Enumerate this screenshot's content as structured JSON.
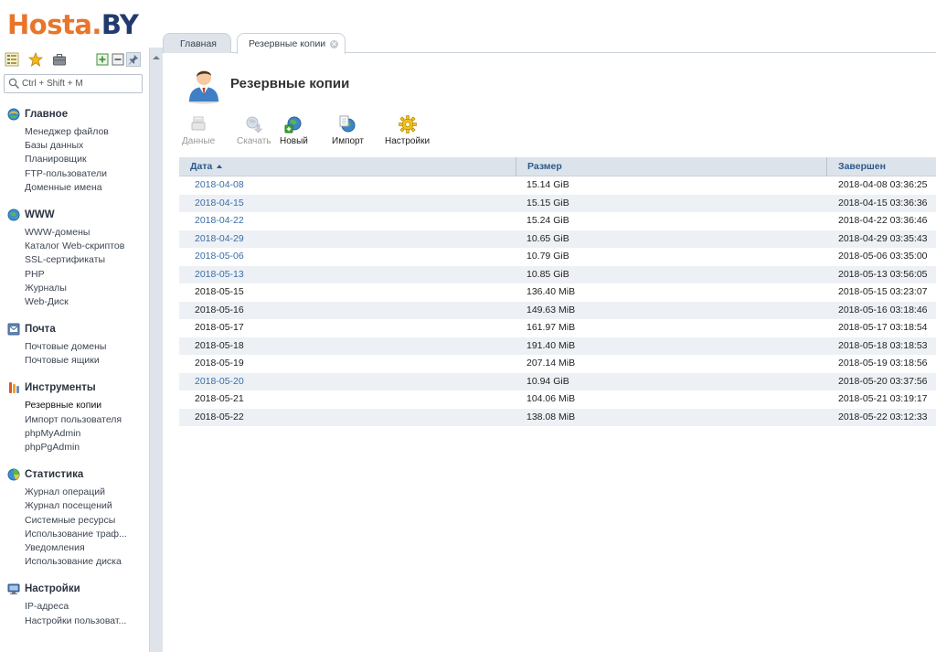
{
  "logo": {
    "part1": "Hosta.",
    "part2": "BY"
  },
  "search": {
    "placeholder": "Ctrl + Shift + M"
  },
  "side_tool_icons": [
    "tree-view-icon",
    "favorites-star-icon",
    "briefcase-icon",
    "expand-all-icon",
    "collapse-all-icon",
    "pin-icon"
  ],
  "menu": [
    {
      "title": "Главное",
      "icon": "home-globe-icon",
      "items": [
        "Менеджер файлов",
        "Базы данных",
        "Планировщик",
        "FTP-пользователи",
        "Доменные имена"
      ]
    },
    {
      "title": "WWW",
      "icon": "www-globe-icon",
      "items": [
        "WWW-домены",
        "Каталог Web-скриптов",
        "SSL-сертификаты",
        "PHP",
        "Журналы",
        "Web-Диск"
      ]
    },
    {
      "title": "Почта",
      "icon": "mail-icon",
      "items": [
        "Почтовые домены",
        "Почтовые ящики"
      ]
    },
    {
      "title": "Инструменты",
      "icon": "tools-icon",
      "items": [
        "Резервные копии",
        "Импорт пользователя",
        "phpMyAdmin",
        "phpPgAdmin"
      ]
    },
    {
      "title": "Статистика",
      "icon": "statistics-pie-icon",
      "items": [
        "Журнал операций",
        "Журнал посещений",
        "Системные ресурсы",
        "Использование траф...",
        "Уведомления",
        "Использование диска"
      ]
    },
    {
      "title": "Настройки",
      "icon": "settings-monitor-icon",
      "items": [
        "IP-адреса",
        "Настройки пользоват..."
      ]
    }
  ],
  "active_menu_item": "Резервные копии",
  "tabs": [
    {
      "label": "Главная",
      "active": false
    },
    {
      "label": "Резервные копии",
      "active": true
    }
  ],
  "page": {
    "title": "Резервные копии",
    "icon": "user-avatar-icon"
  },
  "toolbar": [
    {
      "label": "Данные",
      "icon": "data-icon",
      "disabled": true
    },
    {
      "label": "Скачать",
      "icon": "download-icon",
      "disabled": true
    },
    {
      "label": "Новый",
      "icon": "new-backup-icon",
      "disabled": false
    },
    {
      "label": "Импорт",
      "icon": "import-icon",
      "disabled": false
    },
    {
      "label": "Настройки",
      "icon": "settings-gear-icon",
      "disabled": false
    }
  ],
  "table": {
    "columns": [
      "Дата",
      "Размер",
      "Завершен"
    ],
    "sort_column": "Дата",
    "rows": [
      {
        "date": "2018-04-08",
        "size": "15.14 GiB",
        "done": "2018-04-08 03:36:25",
        "link": true
      },
      {
        "date": "2018-04-15",
        "size": "15.15 GiB",
        "done": "2018-04-15 03:36:36",
        "link": true
      },
      {
        "date": "2018-04-22",
        "size": "15.24 GiB",
        "done": "2018-04-22 03:36:46",
        "link": true
      },
      {
        "date": "2018-04-29",
        "size": "10.65 GiB",
        "done": "2018-04-29 03:35:43",
        "link": true
      },
      {
        "date": "2018-05-06",
        "size": "10.79 GiB",
        "done": "2018-05-06 03:35:00",
        "link": true
      },
      {
        "date": "2018-05-13",
        "size": "10.85 GiB",
        "done": "2018-05-13 03:56:05",
        "link": true
      },
      {
        "date": "2018-05-15",
        "size": "136.40 MiB",
        "done": "2018-05-15 03:23:07",
        "link": false
      },
      {
        "date": "2018-05-16",
        "size": "149.63 MiB",
        "done": "2018-05-16 03:18:46",
        "link": false
      },
      {
        "date": "2018-05-17",
        "size": "161.97 MiB",
        "done": "2018-05-17 03:18:54",
        "link": false
      },
      {
        "date": "2018-05-18",
        "size": "191.40 MiB",
        "done": "2018-05-18 03:18:53",
        "link": false
      },
      {
        "date": "2018-05-19",
        "size": "207.14 MiB",
        "done": "2018-05-19 03:18:56",
        "link": false
      },
      {
        "date": "2018-05-20",
        "size": "10.94 GiB",
        "done": "2018-05-20 03:37:56",
        "link": true
      },
      {
        "date": "2018-05-21",
        "size": "104.06 MiB",
        "done": "2018-05-21 03:19:17",
        "link": false
      },
      {
        "date": "2018-05-22",
        "size": "138.08 MiB",
        "done": "2018-05-22 03:12:33",
        "link": false
      }
    ]
  },
  "colors": {
    "logo_orange": "#e8752a",
    "logo_navy": "#233a6e",
    "link": "#3a6ea5",
    "header_bg": "#dde3ea",
    "row_alt": "#edf1f5"
  }
}
